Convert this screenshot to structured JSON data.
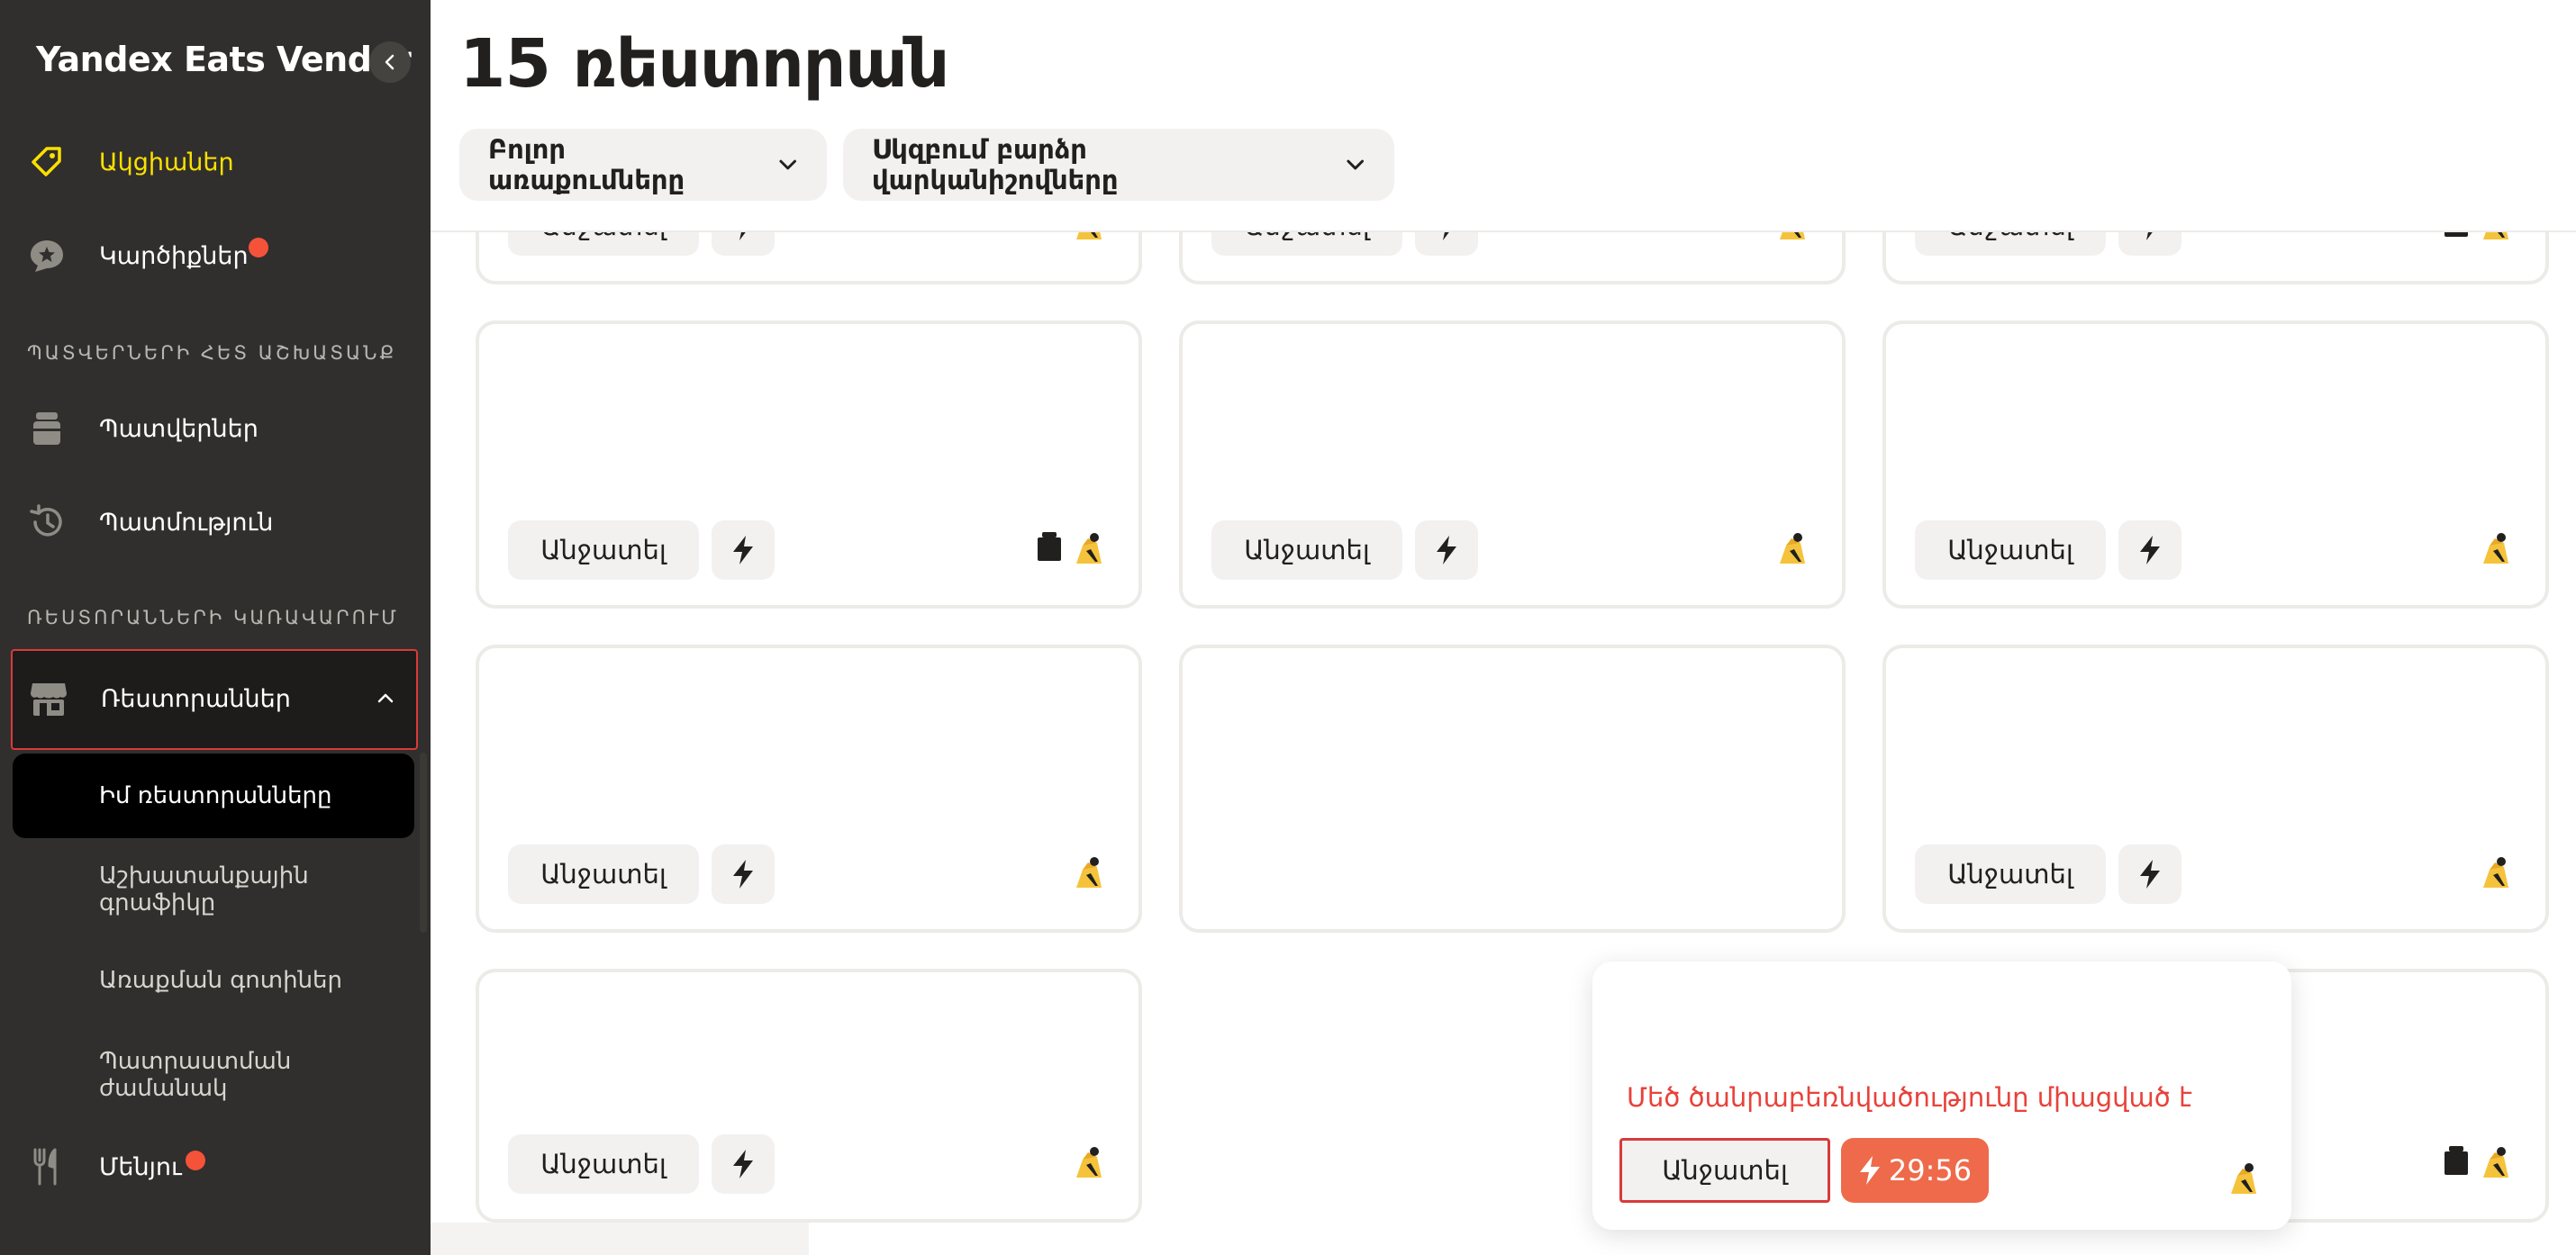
{
  "sidebar": {
    "brand": "Yandex Eats Vendor",
    "nav": {
      "promotions": "Ակցիաներ",
      "reviews": "Կարծիքներ",
      "orders_section": "ՊԱՏՎԵՐՆԵՐԻ ՀԵՏ ԱՇԽԱՏԱՆՔ",
      "orders": "Պատվերներ",
      "history": "Պատմություն",
      "restaurants_section": "ՌԵՍՏՈՐԱՆՆԵՐԻ ԿԱՌԱՎԱՐՈՒՄ",
      "restaurants": "Ռեստորաններ",
      "my_restaurants": "Իմ ռեստորանները",
      "schedule": "Աշխատանքային գրաֆիկը",
      "delivery_zones": "Առաքման գոտիներ",
      "prep_time": "Պատրաստման ժամանակ",
      "menu": "Մենյու"
    }
  },
  "header": {
    "title": "15 ռեստորան",
    "filter_delivery": "Բոլոր առաքումները",
    "filter_sort": "Սկզբում բարձր վարկանիշովները"
  },
  "cards": {
    "pause_label": "Անջատել",
    "warning": "Մեծ ծանրաբեռնվածությունը միացված է",
    "timer": "29:56"
  },
  "colors": {
    "sidebar_bg": "#302f2d",
    "accent_yellow": "#fce000",
    "badge_red": "#f5523a",
    "warning_red": "#e8423a",
    "timer_orange": "#ee6a4a"
  },
  "icons": {
    "promotions": "tag-icon",
    "reviews": "star-bubble-icon",
    "orders": "bag-icon",
    "history": "clock-history-icon",
    "restaurants": "store-icon",
    "menu": "fork-knife-icon",
    "pause_extra": "bolt-icon",
    "pickup": "bag-icon",
    "delivery": "courier-icon"
  }
}
